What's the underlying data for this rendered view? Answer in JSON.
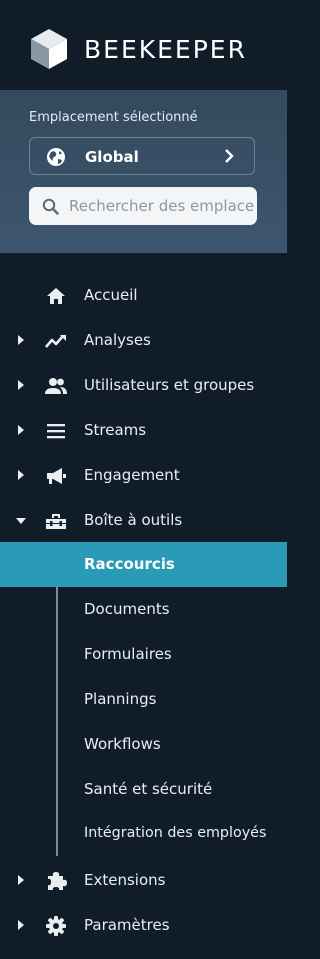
{
  "brand": {
    "name": "BEEKEEPER"
  },
  "location": {
    "label": "Emplacement sélectionné",
    "selected": "Global",
    "search_placeholder": "Rechercher des emplacements"
  },
  "nav": {
    "items": [
      {
        "label": "Accueil",
        "icon": "home-icon"
      },
      {
        "label": "Analyses",
        "icon": "trending-icon"
      },
      {
        "label": "Utilisateurs et groupes",
        "icon": "users-icon"
      },
      {
        "label": "Streams",
        "icon": "menu-lines-icon"
      },
      {
        "label": "Engagement",
        "icon": "megaphone-icon"
      },
      {
        "label": "Boîte à outils",
        "icon": "toolbox-icon"
      },
      {
        "label": "Extensions",
        "icon": "puzzle-icon"
      },
      {
        "label": "Paramètres",
        "icon": "gear-icon"
      }
    ],
    "toolbox_sub": [
      {
        "label": "Raccourcis"
      },
      {
        "label": "Documents"
      },
      {
        "label": "Formulaires"
      },
      {
        "label": "Plannings"
      },
      {
        "label": "Workflows"
      },
      {
        "label": "Santé et sécurité"
      },
      {
        "label": "Intégration des employés"
      }
    ]
  },
  "colors": {
    "background": "#101c28",
    "active": "#2a9bb6",
    "location_panel": "#3a5167"
  }
}
